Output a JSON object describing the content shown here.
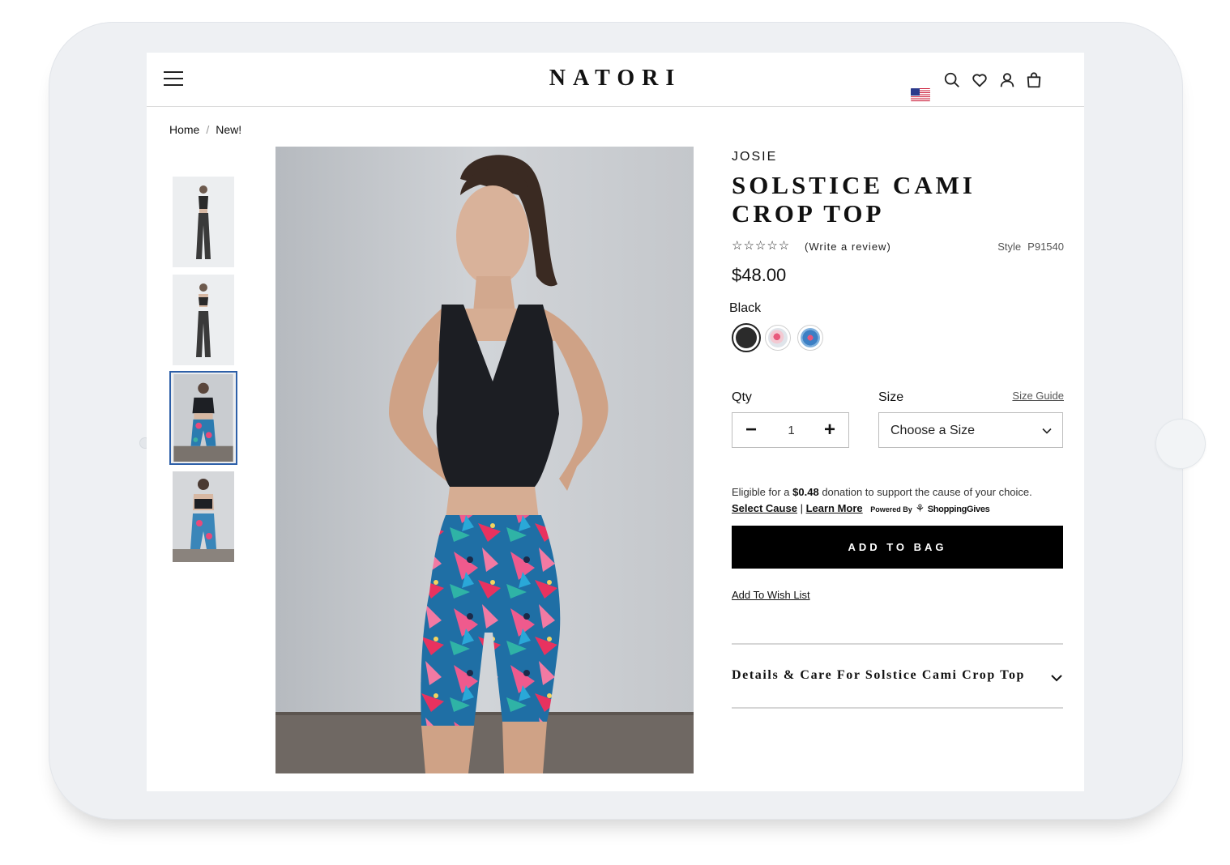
{
  "header": {
    "logo": "NATORI",
    "icons": [
      "menu-icon",
      "us-flag-icon",
      "search-icon",
      "heart-icon",
      "user-icon",
      "bag-icon"
    ]
  },
  "breadcrumb": {
    "home": "Home",
    "separator": "/",
    "current": "New!"
  },
  "gallery": {
    "thumbnails": [
      "front-full-length",
      "back-full-length",
      "front-crop-top-and-shorts",
      "back-crop-top-and-shorts"
    ],
    "active_index": 2
  },
  "product": {
    "brand": "JOSIE",
    "title": "SOLSTICE CAMI CROP TOP",
    "stars": "☆☆☆☆☆",
    "review_link": "(Write a review)",
    "style_label": "Style",
    "style_number": "P91540",
    "price": "$48.00",
    "color_name": "Black",
    "swatches": [
      {
        "name": "Black",
        "color": "#2b2b2b"
      },
      {
        "name": "Pink print",
        "color": "#e9a3b0"
      },
      {
        "name": "Blue print",
        "color": "#4a7fc0"
      }
    ]
  },
  "purchase": {
    "qty_label": "Qty",
    "qty_value": "1",
    "minus": "−",
    "plus": "+",
    "size_label": "Size",
    "size_guide": "Size Guide",
    "size_placeholder": "Choose a Size",
    "eligible_prefix": "Eligible for a ",
    "donation_amount": "$0.48",
    "eligible_suffix": " donation to support the cause of your choice.",
    "select_cause": "Select Cause",
    "divider": "|",
    "learn_more": "Learn More",
    "powered_by": "Powered By",
    "shopping_gives": "ShoppingGives",
    "add_to_bag": "ADD TO BAG",
    "wish_list": "Add To Wish List"
  },
  "details": {
    "label": "Details & Care For Solstice Cami Crop Top"
  },
  "colors": {
    "accent_border": "#2d5fa8",
    "button_bg": "#000000"
  }
}
